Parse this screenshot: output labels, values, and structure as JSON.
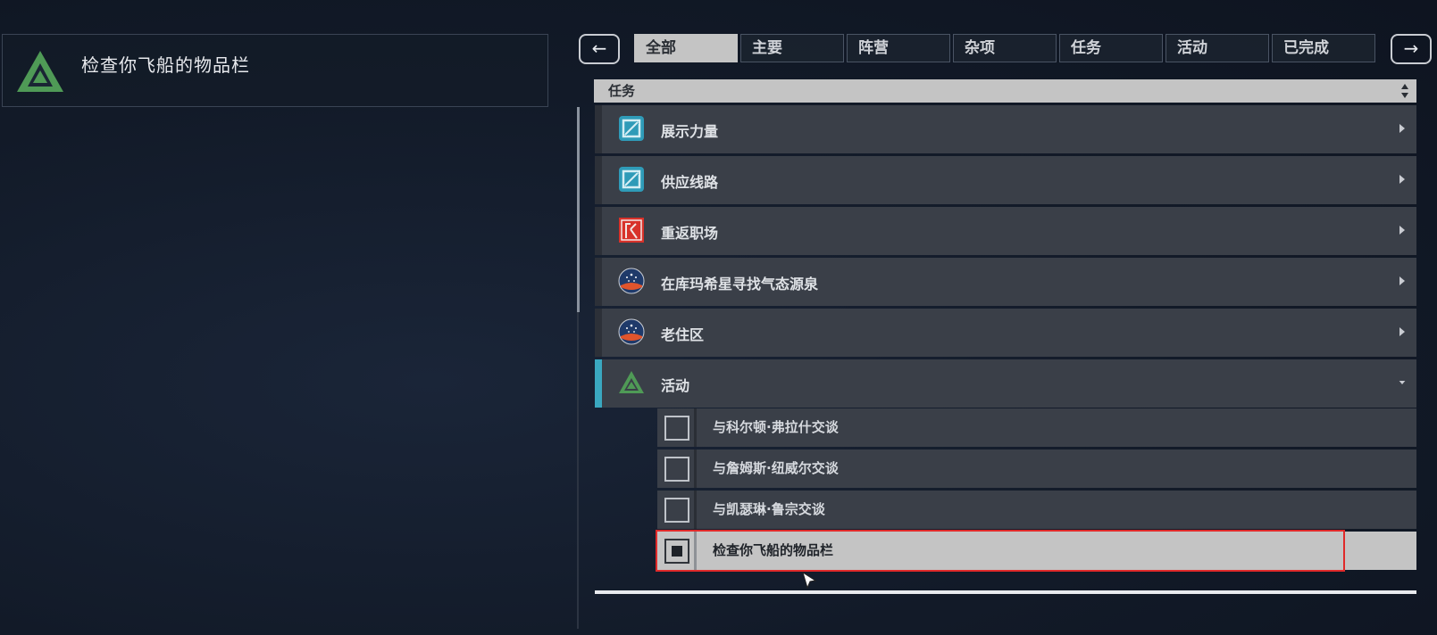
{
  "objective": {
    "text": "检查你飞船的物品栏",
    "icon": "triangle-logo-icon"
  },
  "nav": {
    "prev_label": "←",
    "next_label": "→"
  },
  "tabs": [
    {
      "label": "全部",
      "active": true
    },
    {
      "label": "主要",
      "active": false
    },
    {
      "label": "阵营",
      "active": false
    },
    {
      "label": "杂项",
      "active": false
    },
    {
      "label": "任务",
      "active": false
    },
    {
      "label": "活动",
      "active": false
    },
    {
      "label": "已完成",
      "active": false
    }
  ],
  "category": {
    "label": "任务"
  },
  "missions": [
    {
      "label": "展示力量",
      "icon": "ryujin-icon"
    },
    {
      "label": "供应线路",
      "icon": "ryujin-icon"
    },
    {
      "label": "重返职场",
      "icon": "freestar-icon"
    },
    {
      "label": "在库玛希星寻找气态源泉",
      "icon": "constellation-icon"
    },
    {
      "label": "老住区",
      "icon": "constellation-icon"
    },
    {
      "label": "活动",
      "icon": "triangle-logo-icon",
      "expanded": true
    }
  ],
  "subtasks": [
    {
      "label": "与科尔顿·弗拉什交谈",
      "checked": false
    },
    {
      "label": "与詹姆斯·纽威尔交谈",
      "checked": false
    },
    {
      "label": "与凯瑟琳·鲁宗交谈",
      "checked": false
    },
    {
      "label": "检查你飞船的物品栏",
      "checked": true,
      "selected": true
    }
  ],
  "colors": {
    "accent": "#3aa8c0",
    "highlight": "#e02a2a",
    "active_tab": "#c4c4c4"
  }
}
